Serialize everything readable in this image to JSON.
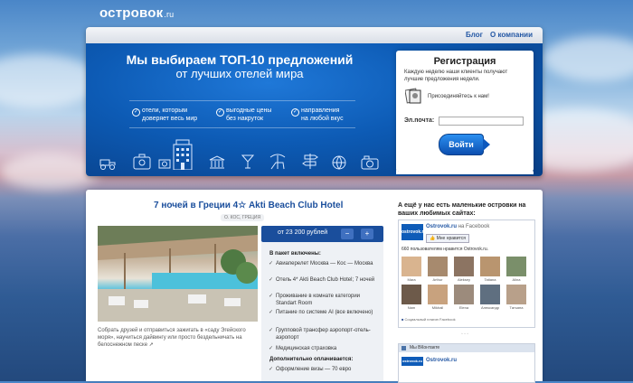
{
  "logo": {
    "text": "островок",
    "suffix": ".ru"
  },
  "nav": {
    "blog": "Блог",
    "about": "О компании"
  },
  "hero": {
    "title": "Мы выбираем ТОП-10 предложений",
    "subtitle": "от лучших отелей мира",
    "features": [
      {
        "line1": "отели, которым",
        "line2": "доверяет весь мир"
      },
      {
        "line1": "выгодные цены",
        "line2": "без накруток"
      },
      {
        "line1": "направления",
        "line2": "на любой вкус"
      }
    ],
    "icons": [
      "tractor-icon",
      "suitcase-icon",
      "camera-icon",
      "hotel-building-icon",
      "beach-umbrella-icon",
      "museum-icon",
      "cocktail-icon",
      "deckchair-icon",
      "signpost-icon",
      "globe-icon",
      "photo-camera-icon"
    ]
  },
  "registration": {
    "title": "Регистрация",
    "intro": "Каждую неделю наши клиенты получают лучшие предложения недели.",
    "join": "Присоединяйтесь к нам!",
    "email_label": "Эл.почта:",
    "email_value": "",
    "submit": "Войти"
  },
  "offer": {
    "title": "7 ночей в Греции 4☆ Akti Beach Club Hotel",
    "tag": "О. КОС, ГРЕЦИЯ",
    "price": "от 23 200 рублей",
    "caption": "Собрать друзей и отправиться зажигать в «саду Эгейского моря», научиться дайвингу или просто бездельничать на белоснежном песке",
    "included_heading": "В пакет включены:",
    "included": [
      "Авиаперелет Москва — Кос — Москва",
      "Отель 4* Akti Beach Club Hotel; 7 ночей",
      "Проживание в комнате категории Standart Room",
      "Питание по системе AI (все включено)",
      "Групповой трансфер аэропорт-отель-аэропорт",
      "Медицинская страховка"
    ],
    "extra_heading": "Дополнительно оплачивается:",
    "extra": [
      "Оформление визы — 70 евро"
    ]
  },
  "sidebar": {
    "title": "А ещё у нас есть маленькие островки на ваших любимых сайтах:",
    "facebook": {
      "page_name": "Ostrovok.ru",
      "on": "на Facebook",
      "logo": "ostrovok.ru",
      "like": "Мне нравится",
      "count_text": "660 пользователям нравится Ostrovok.ru.",
      "fans": [
        "Mara",
        "Arthur",
        "Aleksey",
        "Tatiana",
        "Alina",
        "Nam",
        "Mikhail",
        "Elena",
        "Александр",
        "Татьяна"
      ],
      "plugin": "Социальный плагин Facebook"
    },
    "vk": {
      "header": "Мы ВКонтакте",
      "logo": "ostrovok.ru",
      "name": "Ostrovok.ru"
    }
  }
}
